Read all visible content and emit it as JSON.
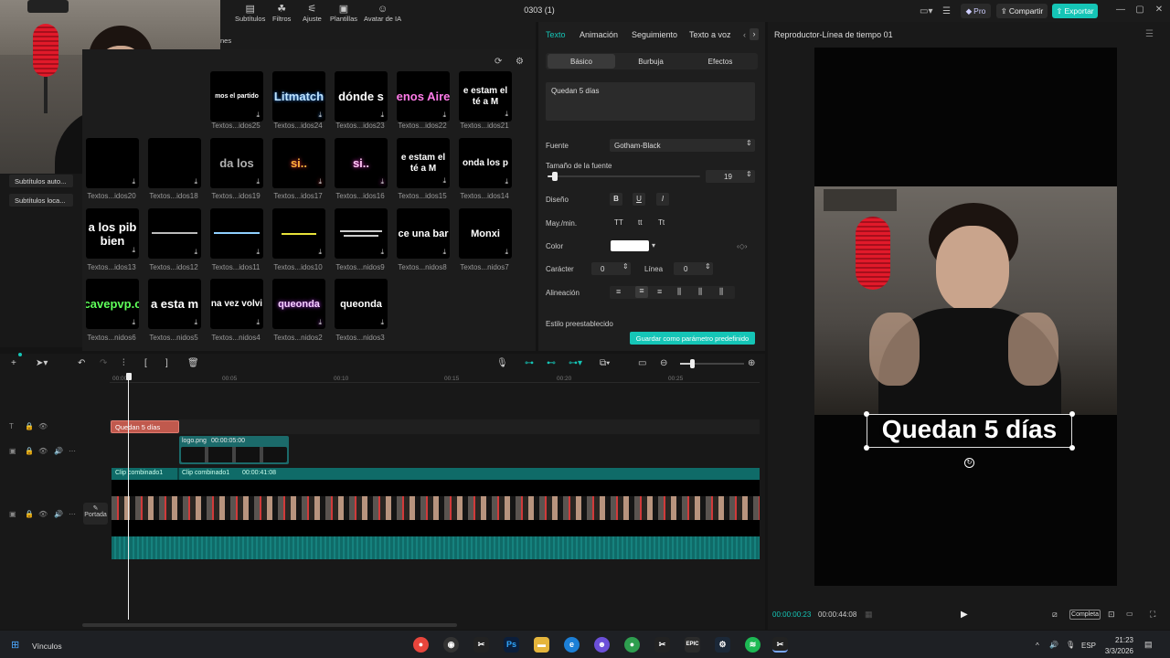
{
  "app": {
    "title": "0303 (1)",
    "pro_label": "Pro",
    "share_label": "Compartir",
    "export_label": "Exportar",
    "accent": "#15c5b6"
  },
  "media_toolbar": [
    "Subtítulos",
    "Filtros",
    "Ajuste",
    "Plantillas",
    "Avatar de IA"
  ],
  "media_toolbar_partial": "nes",
  "left_panel": [
    "Subtítulos auto...",
    "Subtítulos loca..."
  ],
  "text_templates": [
    {
      "preview": "mos el partido",
      "label": "Textos...idos25"
    },
    {
      "preview": "Litmatch",
      "label": "Textos...idos24"
    },
    {
      "preview": "dónde s",
      "label": "Textos...idos23"
    },
    {
      "preview": "enos Aire",
      "label": "Textos...idos22"
    },
    {
      "preview": "e estam el té a M",
      "label": "Textos...idos21"
    },
    {
      "preview": "",
      "label": "Textos...idos20"
    },
    {
      "preview": "",
      "label": "Textos...idos18"
    },
    {
      "preview": "da los",
      "label": "Textos...idos19"
    },
    {
      "preview": "si..",
      "label": "Textos...idos17"
    },
    {
      "preview": "si..",
      "label": "Textos...idos16"
    },
    {
      "preview": "e estam el té a M",
      "label": "Textos...idos15"
    },
    {
      "preview": "onda los p",
      "label": "Textos...idos14"
    },
    {
      "preview": "a los pib bien",
      "label": "Textos...idos13"
    },
    {
      "preview": "",
      "label": "Textos...idos12"
    },
    {
      "preview": "",
      "label": "Textos...idos11"
    },
    {
      "preview": "",
      "label": "Textos...idos10"
    },
    {
      "preview": "",
      "label": "Textos...nidos9"
    },
    {
      "preview": "ce una bar",
      "label": "Textos...nidos8"
    },
    {
      "preview": "Monxi",
      "label": "Textos...nidos7"
    },
    {
      "preview": "cavepvp.c",
      "label": "Textos...nidos6"
    },
    {
      "preview": "a esta m",
      "label": "Textos...nidos5"
    },
    {
      "preview": "na vez volvi",
      "label": "Textos...nidos4"
    },
    {
      "preview": "queonda",
      "label": "Textos...nidos2"
    },
    {
      "preview": "queonda",
      "label": "Textos...nidos3"
    }
  ],
  "props": {
    "tabs": [
      "Texto",
      "Animación",
      "Seguimiento",
      "Texto a voz"
    ],
    "subtabs": [
      "Básico",
      "Burbuja",
      "Efectos"
    ],
    "text_value": "Quedan 5 días",
    "font_label": "Fuente",
    "font_value": "Gotham-Black",
    "size_label": "Tamaño de la fuente",
    "size_value": "19",
    "size_level": 0.05,
    "design_label": "Diseño",
    "case_label": "May./min.",
    "case_opts": [
      "TT",
      "tt",
      "Tt"
    ],
    "color_label": "Color",
    "color_value": "#ffffff",
    "char_label": "Carácter",
    "char_value": "0",
    "line_label": "Línea",
    "line_value": "0",
    "align_label": "Alineación",
    "preset_label": "Estilo preestablecido",
    "save_preset": "Guardar como parámetro predefinido"
  },
  "player": {
    "title": "Reproductor-Línea de tiempo 01",
    "caption": "Quedan 5 días",
    "current_time": "00:00:00:23",
    "total_time": "00:00:44:08",
    "quality": "Completa"
  },
  "timeline": {
    "ruler": [
      "00:00",
      "00:05",
      "00:10",
      "00:15",
      "00:20",
      "00:25"
    ],
    "text_clip": "Quedan 5 días",
    "logo_clip": {
      "name": "logo.png",
      "duration": "00:00:05:00"
    },
    "main_clip_a": "Clip combinado1",
    "main_clip_b": {
      "name": "Clip combinado1",
      "duration": "00:00:41:08"
    },
    "cover_label": "Portada"
  },
  "taskbar": {
    "search_label": "Vínculos",
    "lang": "ESP",
    "time": "21:23",
    "date": "3/3/2026"
  }
}
